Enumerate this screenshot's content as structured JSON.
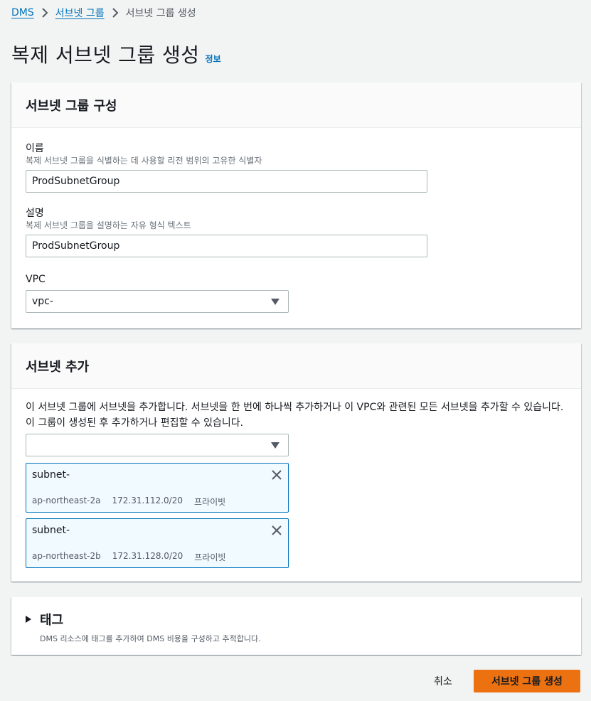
{
  "breadcrumb": {
    "items": [
      "DMS",
      "서브넷 그룹"
    ],
    "current": "서브넷 그룹 생성"
  },
  "page": {
    "title": "복제 서브넷 그룹 생성",
    "info": "정보"
  },
  "config": {
    "title": "서브넷 그룹 구성",
    "name": {
      "label": "이름",
      "desc": "복제 서브넷 그룹을 식별하는 데 사용할 리전 범위의 고유한 식별자",
      "value": "ProdSubnetGroup"
    },
    "description": {
      "label": "설명",
      "desc": "복제 서브넷 그룹을 설명하는 자유 형식 텍스트",
      "value": "ProdSubnetGroup"
    },
    "vpc": {
      "label": "VPC",
      "value": "vpc-"
    }
  },
  "subnets": {
    "title": "서브넷 추가",
    "help": "이 서브넷 그룹에 서브넷을 추가합니다. 서브넷을 한 번에 하나씩 추가하거나 이 VPC와 관련된 모든 서브넷을 추가할 수 있습니다. 이 그룹이 생성된 후 추가하거나 편집할 수 있습니다.",
    "select_value": "",
    "tokens": [
      {
        "name": "subnet-",
        "az": "ap-northeast-2a",
        "cidr": "172.31.112.0/20",
        "type": "프라이빗"
      },
      {
        "name": "subnet-",
        "az": "ap-northeast-2b",
        "cidr": "172.31.128.0/20",
        "type": "프라이빗"
      }
    ]
  },
  "tags": {
    "title": "태그",
    "desc": "DMS 리소스에 태그를 추가하여 DMS 비용을 구성하고 추적합니다."
  },
  "actions": {
    "cancel": "취소",
    "create": "서브넷 그룹 생성"
  },
  "colors": {
    "link": "#0073bb",
    "primary": "#ec7211",
    "token_bg": "#f1faff",
    "token_border": "#0073bb"
  }
}
